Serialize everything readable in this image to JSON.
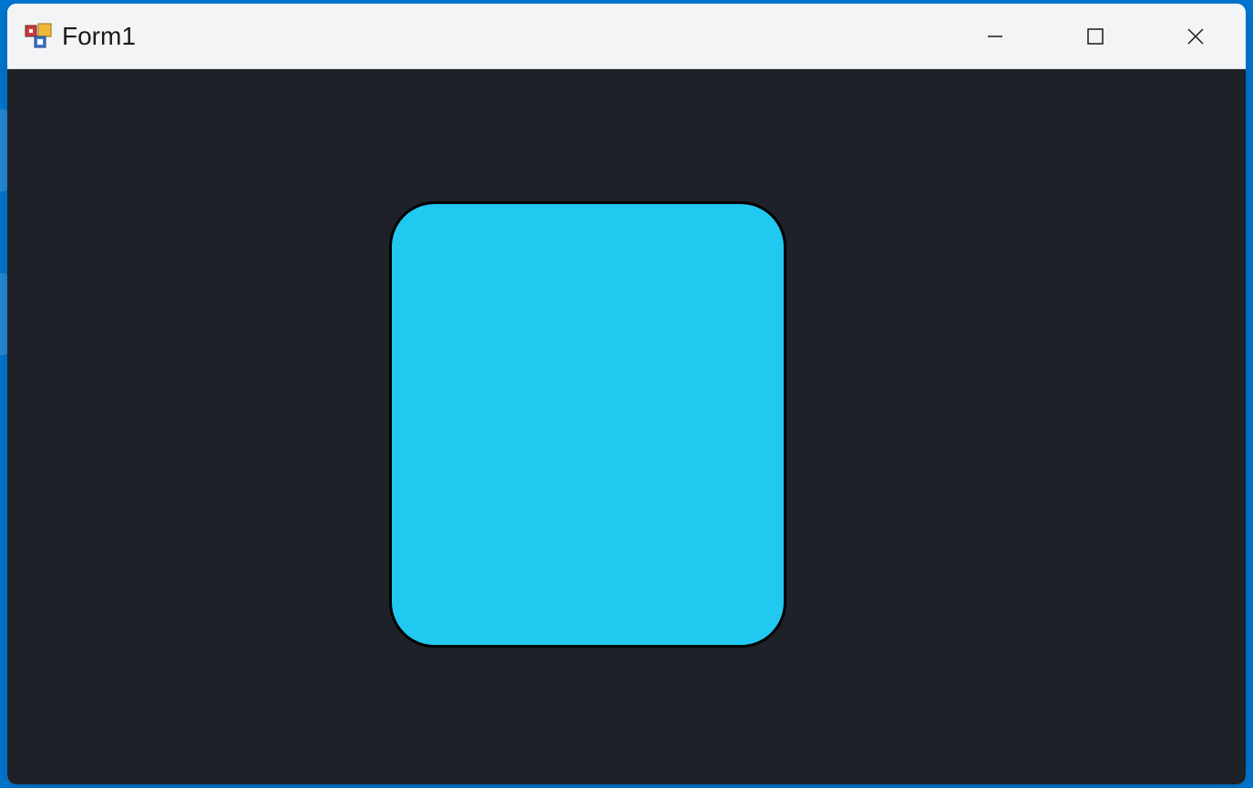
{
  "window": {
    "title": "Form1"
  },
  "controls": {
    "minimize": "minimize",
    "maximize": "maximize",
    "close": "close"
  },
  "panel": {
    "fill_color": "#21c8f0",
    "border_color": "#000000",
    "corner_radius": 50
  },
  "client_background": "#1e2128"
}
